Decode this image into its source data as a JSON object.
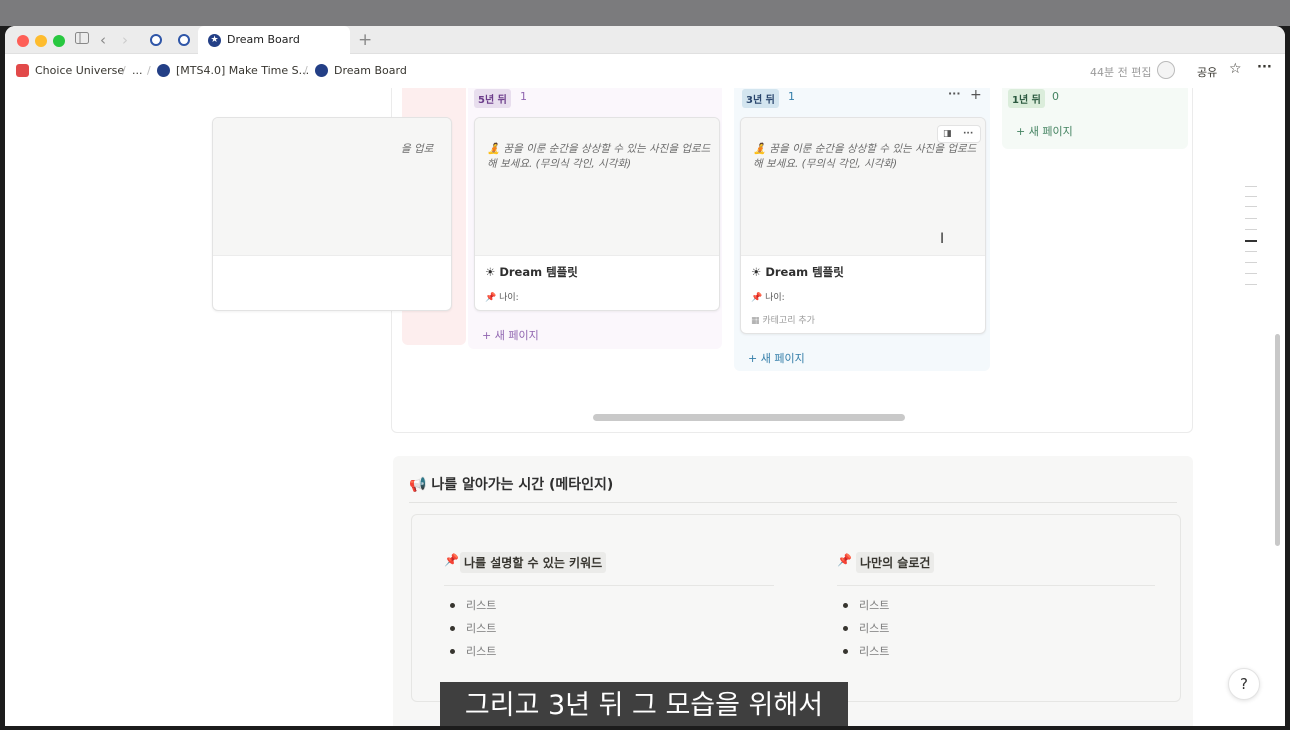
{
  "browser": {
    "tab_title": "Dream Board",
    "new_tab_label": "+"
  },
  "breadcrumb": {
    "item1": "Choice Universe",
    "ellipsis": "...",
    "item2": "[MTS4.0] Make Time S...",
    "item3": "Dream Board"
  },
  "topbar": {
    "edited": "44분 전 편집",
    "share": "공유"
  },
  "board": {
    "columns": [
      {
        "tag": "5년 뒤",
        "count": "1",
        "card_hint": "꿈을 이룬 순간을 상상할 수 있는 사진을 업로드해 보세요. (무의식 각인, 시각화)",
        "card_title": "Dream 템플릿",
        "card_prop": "나이:",
        "new_page": "새 페이지"
      },
      {
        "tag": "3년 뒤",
        "count": "1",
        "card_hint": "꿈을 이룬 순간을 상상할 수 있는 사진을 업로드해 보세요. (무의식 각인, 시각화)",
        "card_title": "Dream 템플릿",
        "card_prop": "나이:",
        "card_category": "카테고리 추가",
        "new_page": "새 페이지"
      },
      {
        "tag": "1년 뒤",
        "count": "0",
        "new_page": "새 페이지"
      }
    ],
    "partial_hint": "을 업로",
    "colors": {
      "purple_tag_bg": "#e8deee",
      "purple_text": "#9065b0",
      "blue_tag_bg": "#d3e5ef",
      "blue_text": "#337ea9",
      "green_tag_bg": "#dbeddb",
      "green_text": "#448361"
    }
  },
  "section": {
    "title": "나를 알아가는 시간 (메타인지)",
    "left_title": "나를 설명할 수 있는 키워드",
    "right_title": "나만의 슬로건",
    "left_items": [
      "리스트",
      "리스트",
      "리스트"
    ],
    "right_items": [
      "리스트",
      "리스트",
      "리스트"
    ]
  },
  "subtitle": "그리고 3년 뒤 그 모습을 위해서"
}
